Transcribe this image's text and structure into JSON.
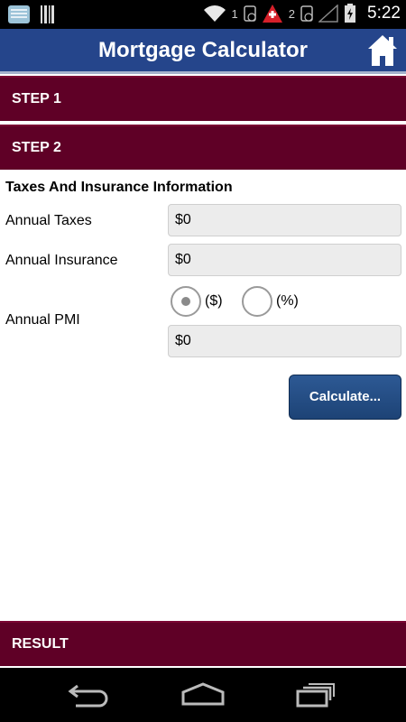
{
  "status_bar": {
    "sim1_label": "1",
    "sim2_label": "2",
    "time": "5:22"
  },
  "app": {
    "title": "Mortgage Calculator"
  },
  "steps": {
    "step1": "STEP 1",
    "step2": "STEP 2",
    "result": "RESULT"
  },
  "form": {
    "section_title": "Taxes And Insurance Information",
    "annual_taxes_label": "Annual Taxes",
    "annual_taxes_value": "$0",
    "annual_insurance_label": "Annual Insurance",
    "annual_insurance_value": "$0",
    "annual_pmi_label": "Annual PMI",
    "pmi_option_dollar": "($)",
    "pmi_option_percent": "(%)",
    "pmi_selected": "($)",
    "annual_pmi_value": "$0",
    "calculate_label": "Calculate..."
  },
  "colors": {
    "action_bar": "#25458b",
    "step_header": "#5f0026",
    "button": "#1d4376"
  },
  "icons": {
    "home": "home-icon",
    "back": "back-icon",
    "nav_home": "nav-home-icon",
    "recents": "recents-icon"
  }
}
